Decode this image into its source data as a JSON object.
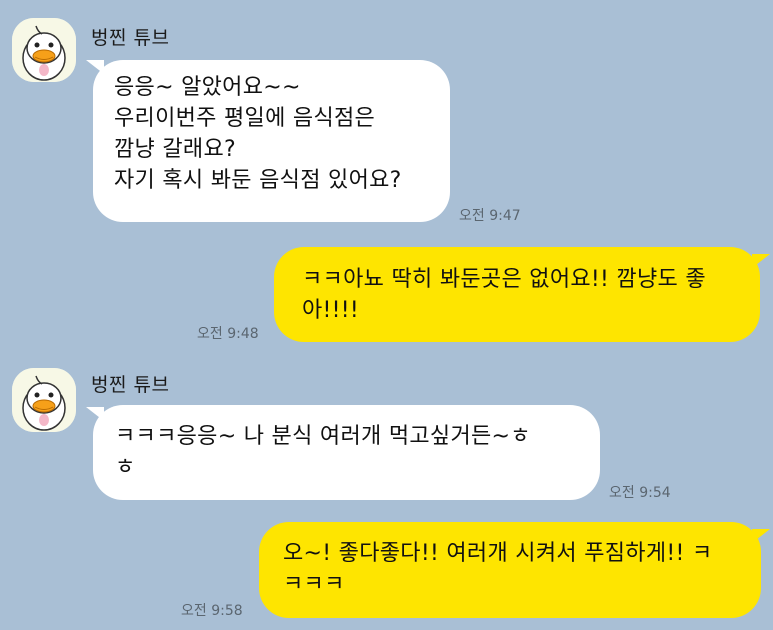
{
  "chat": {
    "messages": [
      {
        "sender": "벙찐 튜브",
        "lines": [
          "응응~ 알았어요~~",
          "우리이번주 평일에 음식점은",
          "깜냥 갈래요?",
          "자기 혹시 봐둔 음식점 있어요?"
        ],
        "time": "오전 9:47"
      },
      {
        "lines": [
          "ㅋㅋ아뇨 딱히 봐둔곳은 없어요!! 깜냥도 좋",
          "아!!!!"
        ],
        "time": "오전 9:48"
      },
      {
        "sender": "벙찐 튜브",
        "lines": [
          "ㅋㅋㅋ응응~ 나 분식 여러개 먹고싶거든~ㅎ",
          "ㅎ"
        ],
        "time": "오전 9:54"
      },
      {
        "lines": [
          "오~! 좋다좋다!! 여러개 시켜서 푸짐하게!! ㅋ",
          "ㅋㅋㅋ"
        ],
        "time": "오전 9:58"
      }
    ]
  }
}
